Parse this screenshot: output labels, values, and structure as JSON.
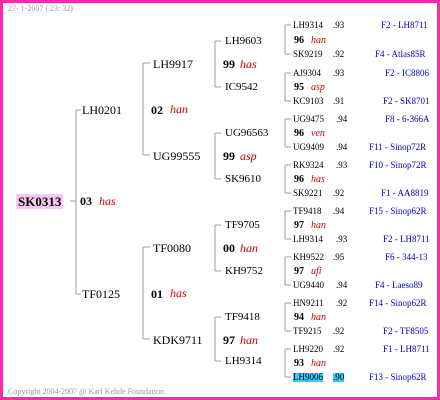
{
  "header": {
    "date_text": "27- 1-2007 ( 23: 32)"
  },
  "footer": {
    "copyright": "Copyright 2004-2007 @ Karl Kehde Foundation."
  },
  "root": {
    "label": "SK0313",
    "year": "03",
    "code": "has"
  },
  "gen1": [
    {
      "id": "LH0201"
    },
    {
      "id": "TF0125"
    }
  ],
  "gen2": [
    {
      "year": "02",
      "code": "han"
    },
    {
      "year": "01",
      "code": "has"
    }
  ],
  "gen2_ids": [
    {
      "id": "LH9917"
    },
    {
      "id": "UG99555"
    },
    {
      "id": "TF0080"
    },
    {
      "id": "KDK9711"
    }
  ],
  "gen3": [
    {
      "year": "99",
      "code": "has"
    },
    {
      "year": "99",
      "code": "asp"
    },
    {
      "year": "00",
      "code": "han"
    },
    {
      "year": "97",
      "code": "han"
    }
  ],
  "gen3_ids": [
    {
      "id": "LH9603"
    },
    {
      "id": "IC9542"
    },
    {
      "id": "UG96563"
    },
    {
      "id": "SK9610"
    },
    {
      "id": "TF9705"
    },
    {
      "id": "KH9752"
    },
    {
      "id": "TF9418"
    },
    {
      "id": "LH9314"
    }
  ],
  "leaves": [
    {
      "id": "LH9314",
      "score": ".93",
      "right": "F2 - LH8711"
    },
    {
      "year": "96",
      "code": "han"
    },
    {
      "id": "SK9219",
      "score": ".92",
      "right": "F4 - Atlas85R"
    },
    {
      "id": "AJ9304",
      "score": ".93",
      "right": "F2 - IC8806"
    },
    {
      "year": "95",
      "code": "asp"
    },
    {
      "id": "KC9103",
      "score": ".91",
      "right": "F2 - SK8701"
    },
    {
      "id": "UG9475",
      "score": ".94",
      "right": "F8 - 6-366A"
    },
    {
      "year": "96",
      "code": "ven"
    },
    {
      "id": "UG9409",
      "score": ".94",
      "right": "F11 - Sinop72R"
    },
    {
      "id": "RK9324",
      "score": ".93",
      "right": "F10 - Sinop72R"
    },
    {
      "year": "96",
      "code": "has"
    },
    {
      "id": "SK9221",
      "score": ".92",
      "right": "F1 - AA8819"
    },
    {
      "id": "TF9418",
      "score": ".94",
      "right": "F15 - Sinop62R"
    },
    {
      "year": "97",
      "code": "han"
    },
    {
      "id": "LH9314",
      "score": ".93",
      "right": "F2 - LH8711"
    },
    {
      "id": "KH9522",
      "score": ".95",
      "right": "F6 - 344-13"
    },
    {
      "year": "97",
      "code": "ufi"
    },
    {
      "id": "UG9440",
      "score": ".94",
      "right": "F4 - Laeso89"
    },
    {
      "id": "HN9211",
      "score": ".92",
      "right": "F14 - Sinop62R"
    },
    {
      "year": "94",
      "code": "han"
    },
    {
      "id": "TF9215",
      "score": ".92",
      "right": "F2 - TF8505"
    },
    {
      "id": "LH9220",
      "score": ".92",
      "right": "F1 - LH8711"
    },
    {
      "year": "93",
      "code": "han"
    },
    {
      "id": "LH9006",
      "score": ".90",
      "right": "F13 - Sinop62R"
    }
  ],
  "colors": {
    "border": "#ff2aa8",
    "right_text": "#0000cc",
    "code_text": "#d00000",
    "highlight": "#33ccff",
    "root_bg": "#f4c7f4"
  }
}
